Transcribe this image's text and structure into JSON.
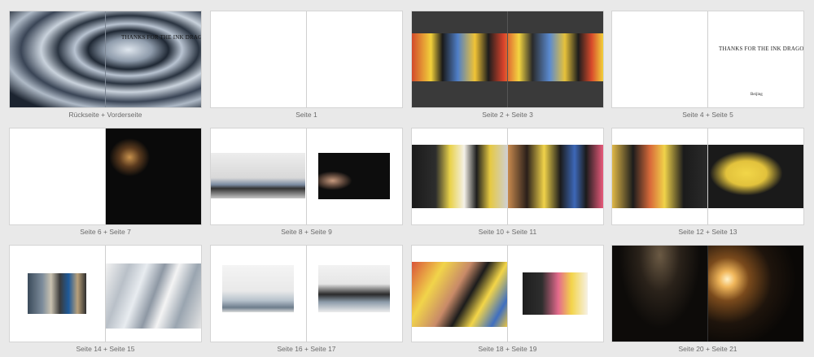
{
  "spreads": [
    {
      "caption": "Rückseite + Vorderseite",
      "title": "THANKS FOR THE INK DRAGON"
    },
    {
      "caption": "Seite 1"
    },
    {
      "caption": "Seite 2 + Seite 3"
    },
    {
      "caption": "Seite 4 + Seite 5",
      "title": "THANKS FOR THE INK DRAGON",
      "subtitle": "Beijing"
    },
    {
      "caption": "Seite 6 + Seite 7"
    },
    {
      "caption": "Seite 8 + Seite 9"
    },
    {
      "caption": "Seite 10 + Seite 11"
    },
    {
      "caption": "Seite 12 + Seite 13"
    },
    {
      "caption": "Seite 14 + Seite 15"
    },
    {
      "caption": "Seite 16 + Seite 17"
    },
    {
      "caption": "Seite 18 + Seite 19"
    },
    {
      "caption": "Seite 20 + Seite 21"
    }
  ],
  "colors": {
    "background": "#e9e9e9",
    "page": "#ffffff",
    "caption": "#6a6a6a",
    "dark_spread": "#3a3a3a"
  }
}
